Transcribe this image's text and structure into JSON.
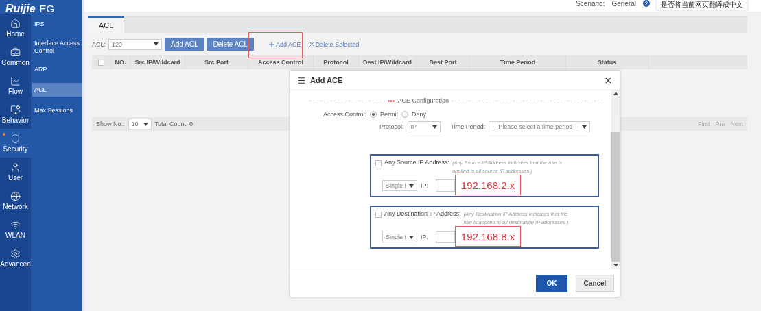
{
  "header": {
    "brand": "Ruijie",
    "product": "EG",
    "scenario_label": "Scenario:",
    "scenario_value": "General",
    "translate_prompt": "是否将当前网页翻译成中文"
  },
  "nav": [
    {
      "label": "Home",
      "selected": false
    },
    {
      "label": "Common",
      "selected": false
    },
    {
      "label": "Flow",
      "selected": false
    },
    {
      "label": "Behavior",
      "selected": false
    },
    {
      "label": "Security",
      "selected": true
    },
    {
      "label": "User",
      "selected": false
    },
    {
      "label": "Network",
      "selected": false
    },
    {
      "label": "WLAN",
      "selected": false
    },
    {
      "label": "Advanced",
      "selected": false
    }
  ],
  "subnav": [
    {
      "label": "IPS",
      "selected": false
    },
    {
      "label": "Interface Access Control",
      "selected": false
    },
    {
      "label": "ARP",
      "selected": false
    },
    {
      "label": "ACL",
      "selected": true
    },
    {
      "label": "Max Sessions",
      "selected": false
    }
  ],
  "tabs": [
    {
      "label": "ACL",
      "selected": true
    }
  ],
  "toolbar": {
    "acl_label": "ACL:",
    "acl_value": "120",
    "buttons": [
      "Add ACL",
      "Delete ACL"
    ],
    "links": [
      {
        "label": "Add ACE",
        "kind": "add",
        "highlighted": true
      },
      {
        "label": "Delete Selected",
        "kind": "delete",
        "highlighted": false
      }
    ]
  },
  "table": {
    "select_all_checked": false,
    "columns": [
      "NO.",
      "Src IP/Wildcard",
      "Src Port",
      "Access Control",
      "Protocol",
      "Dest IP/Wildcard",
      "Dest Port",
      "Time Period",
      "Status"
    ]
  },
  "footer": {
    "show_label": "Show No.:",
    "show_value": "10",
    "total": "Total Count: 0",
    "pager": [
      "First",
      "Pre",
      "Next"
    ]
  },
  "modal": {
    "title": "Add ACE",
    "section": "ACE Configuration",
    "access_control": {
      "label": "Access Control:",
      "options": [
        {
          "label": "Permit",
          "selected": true
        },
        {
          "label": "Deny",
          "selected": false
        }
      ]
    },
    "protocol": {
      "label": "Protocol:",
      "value": "IP"
    },
    "time_period": {
      "label": "Time Period:",
      "value": "---Please select a time period---"
    },
    "ip_groups": [
      {
        "label": "Any Source IP Address:",
        "checked": false,
        "hint": "(Any Source IP Address indicates that the rule is applied to all source IP addresses.)",
        "type": "Single I",
        "ip_label": "IP:",
        "annotation": "192.168.2.x"
      },
      {
        "label": "Any Destination IP Address:",
        "checked": false,
        "hint": "(Any Destination IP Address indicates that the rule is applied to all destination IP addresses.)",
        "type": "Single I",
        "ip_label": "IP:",
        "annotation": "192.168.8.x"
      }
    ],
    "buttons": [
      {
        "label": "OK",
        "kind": "primary"
      },
      {
        "label": "Cancel",
        "kind": "secondary"
      }
    ]
  }
}
